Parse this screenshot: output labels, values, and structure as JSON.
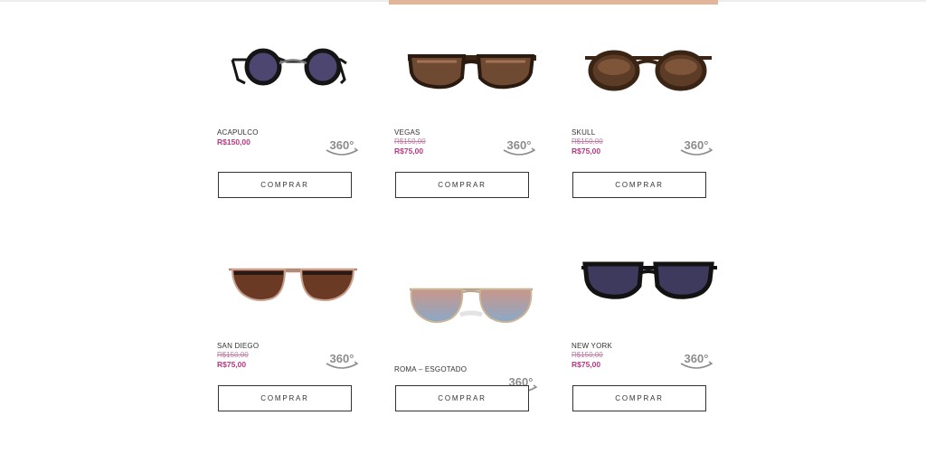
{
  "colors": {
    "accent": "#b33a82",
    "old_price": "#c07aa6",
    "button_border": "#333333"
  },
  "products": [
    {
      "name": "ACAPULCO",
      "price": "R$150,00",
      "badge": "360°",
      "button": "COMPRAR",
      "image_icon": "round-dark-sunglasses-icon"
    },
    {
      "name": "VEGAS",
      "old_price": "R$150,00",
      "price": "R$75,00",
      "badge": "360°",
      "button": "COMPRAR",
      "image_icon": "tortoise-wayfarer-sunglasses-icon"
    },
    {
      "name": "SKULL",
      "old_price": "R$150,00",
      "price": "R$75,00",
      "badge": "360°",
      "button": "COMPRAR",
      "image_icon": "tortoise-round-sunglasses-icon"
    },
    {
      "name": "SAN DIEGO",
      "old_price": "R$150,00",
      "price": "R$75,00",
      "badge": "360°",
      "button": "COMPRAR",
      "image_icon": "brown-double-bridge-sunglasses-icon"
    },
    {
      "name": "ROMA – ESGOTADO",
      "badge": "360°",
      "button": "COMPRAR",
      "image_icon": "gradient-aviator-sunglasses-icon"
    },
    {
      "name": "NEW YORK",
      "old_price": "R$150,00",
      "price": "R$75,00",
      "badge": "360°",
      "button": "COMPRAR",
      "image_icon": "dark-wayfarer-sunglasses-icon"
    }
  ]
}
